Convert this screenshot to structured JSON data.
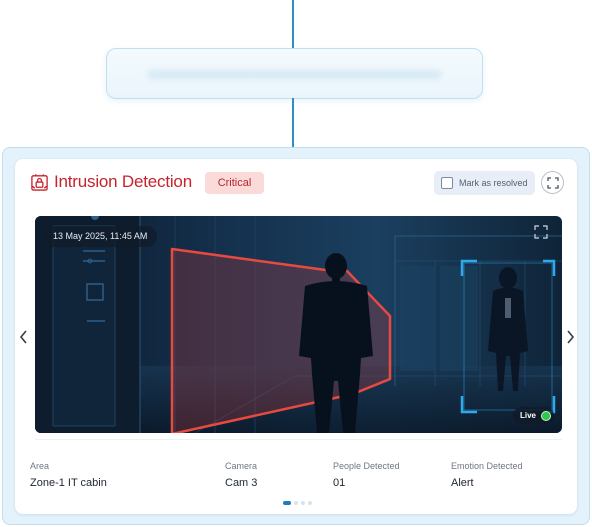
{
  "alert_card": {
    "title": "Intrusion Detection",
    "severity": "Critical",
    "mark_resolved_label": "Mark as resolved",
    "resolved": false,
    "timestamp": "13 May 2025, 11:45 AM",
    "live_label": "Live",
    "colors": {
      "accent": "#c8232c",
      "severity_bg": "#fbdada",
      "live": "#2ec84a",
      "nav_active": "#1f7bbf"
    },
    "details": [
      {
        "label": "Area",
        "value": "Zone-1 IT cabin"
      },
      {
        "label": "Camera",
        "value": "Cam 3"
      },
      {
        "label": "People Detected",
        "value": "01"
      },
      {
        "label": "Emotion Detected",
        "value": "Alert"
      }
    ],
    "pagination": {
      "current": 1,
      "total": 4
    }
  }
}
